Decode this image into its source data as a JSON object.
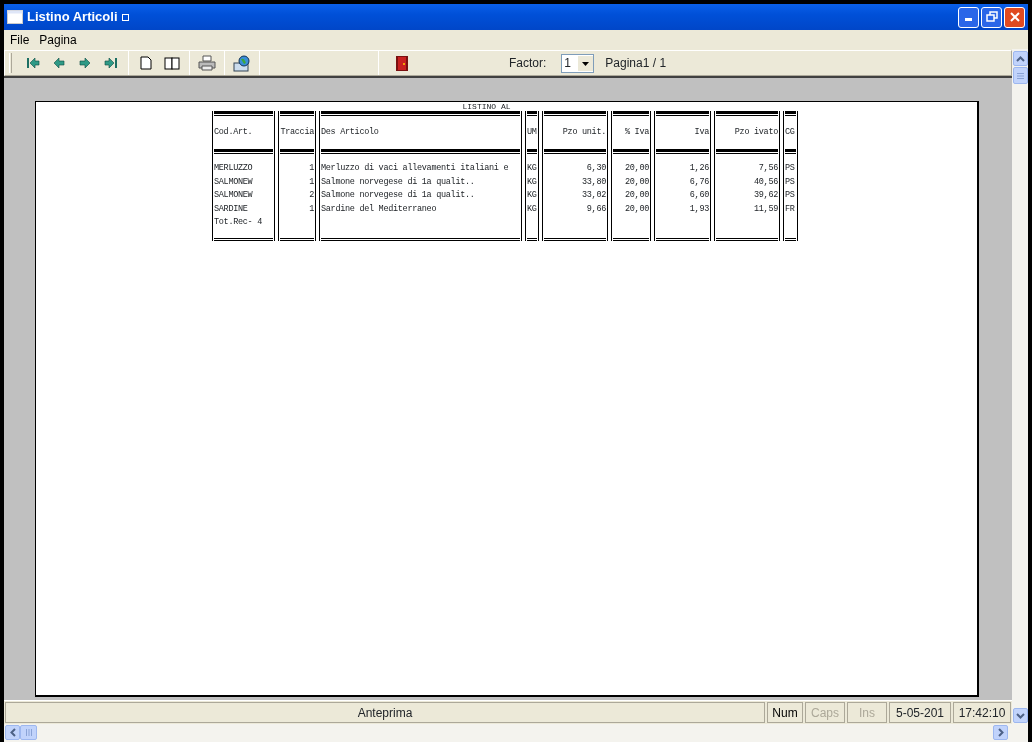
{
  "window": {
    "title": "Listino Articoli"
  },
  "menu": [
    "File",
    "Pagina"
  ],
  "toolbar": {
    "factor_label": "Factor:",
    "factor_value": "1",
    "page_label": "Pagina1 / 1"
  },
  "report": {
    "title": "LISTINO AL",
    "columns": [
      {
        "label": "Cod.Art.",
        "numeric": false
      },
      {
        "label": "Traccia",
        "numeric": true
      },
      {
        "label": "Des Articolo",
        "numeric": false
      },
      {
        "label": "UM",
        "numeric": false
      },
      {
        "label": "Pzo unit.",
        "numeric": true
      },
      {
        "label": "% Iva",
        "numeric": true
      },
      {
        "label": "Iva",
        "numeric": true
      },
      {
        "label": "Pzo ivato",
        "numeric": true
      },
      {
        "label": "CG",
        "numeric": false
      }
    ],
    "rows": [
      [
        "MERLUZZO",
        "1",
        "Merluzzo di vaci allevamenti italiani e",
        "KG",
        "6,30",
        "20,00",
        "1,26",
        "7,56",
        "PS"
      ],
      [
        "SALMONEW",
        "1",
        "Salmone norvegese di 1a qualit..",
        "KG",
        "33,80",
        "20,00",
        "6,76",
        "40,56",
        "PS"
      ],
      [
        "SALMONEW",
        "2",
        "Salmone norvegese di 1a qualit..",
        "KG",
        "33,02",
        "20,00",
        "6,60",
        "39,62",
        "PS"
      ],
      [
        "SARDINE",
        "1",
        "Sardine del Mediterraneo",
        "KG",
        "9,66",
        "20,00",
        "1,93",
        "11,59",
        "FR"
      ]
    ],
    "footer": "Tot.Rec- 4"
  },
  "status_bar": {
    "message": "Anteprima",
    "indicators": [
      {
        "label": "Num",
        "on": true
      },
      {
        "label": "Caps",
        "on": false
      },
      {
        "label": "Ins",
        "on": false
      }
    ],
    "date": "5-05-201",
    "time": "17:42:10"
  }
}
